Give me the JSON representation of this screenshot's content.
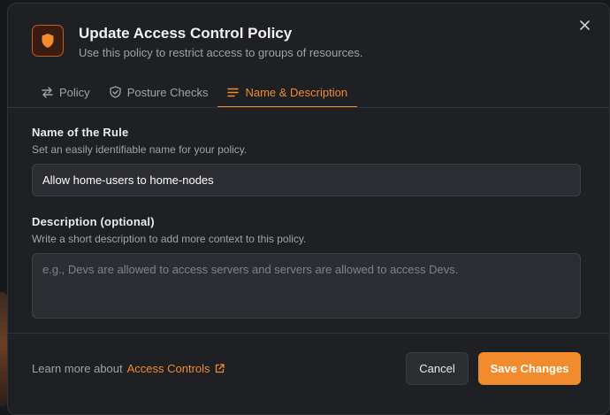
{
  "dialog": {
    "title": "Update Access Control Policy",
    "subtitle": "Use this policy to restrict access to groups of resources.",
    "icon": "shield-icon",
    "accent_color": "#f28a2e"
  },
  "tabs": [
    {
      "label": "Policy",
      "icon": "arrows-swap-icon",
      "active": false
    },
    {
      "label": "Posture Checks",
      "icon": "shield-check-icon",
      "active": false
    },
    {
      "label": "Name & Description",
      "icon": "text-lines-icon",
      "active": true
    }
  ],
  "name_field": {
    "label": "Name of the Rule",
    "help": "Set an easily identifiable name for your policy.",
    "value": "Allow home-users to home-nodes"
  },
  "description_field": {
    "label": "Description (optional)",
    "help": "Write a short description to add more context to this policy.",
    "value": "",
    "placeholder": "e.g., Devs are allowed to access servers and servers are allowed to access Devs."
  },
  "footer": {
    "learn_more": "Learn more about",
    "link_label": "Access Controls",
    "cancel_label": "Cancel",
    "save_label": "Save Changes"
  }
}
